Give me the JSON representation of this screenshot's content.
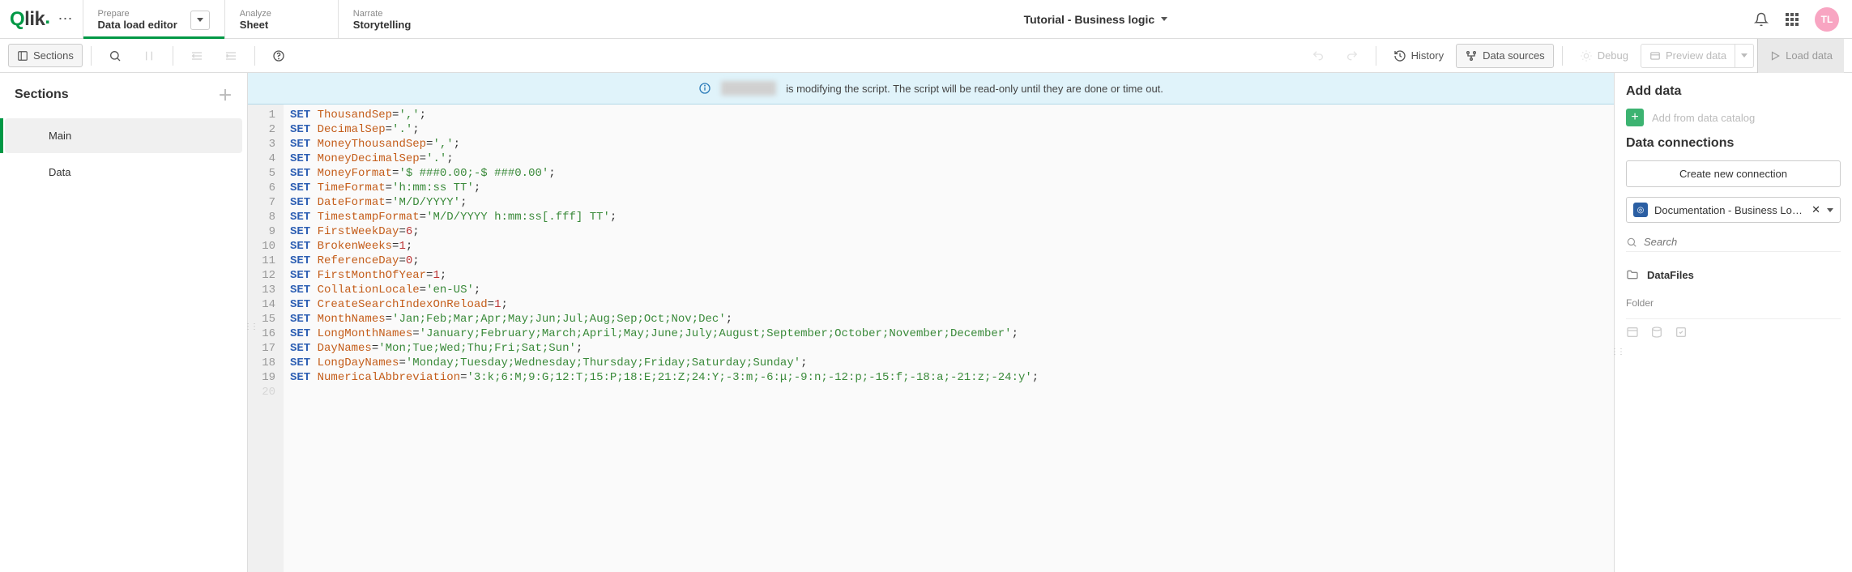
{
  "header": {
    "logo": "Qlik",
    "tabs": [
      {
        "small": "Prepare",
        "big": "Data load editor",
        "active": true,
        "hasDropdown": true
      },
      {
        "small": "Analyze",
        "big": "Sheet"
      },
      {
        "small": "Narrate",
        "big": "Storytelling"
      }
    ],
    "title": "Tutorial - Business logic",
    "avatarInitials": "TL"
  },
  "toolbar": {
    "sections": "Sections",
    "history": "History",
    "dataSources": "Data sources",
    "debug": "Debug",
    "previewData": "Preview data",
    "loadData": "Load data"
  },
  "sectionsPanel": {
    "title": "Sections",
    "items": [
      "Main",
      "Data"
    ],
    "activeIndex": 0
  },
  "banner": {
    "text_suffix": "is modifying the script. The script will be read-only until they are done or time out."
  },
  "code": {
    "lines": [
      {
        "n": 1,
        "kw": "SET",
        "var": "ThousandSep",
        "rest": "=','",
        "type": "str",
        "val": "','"
      },
      {
        "n": 2,
        "kw": "SET",
        "var": "DecimalSep",
        "rest": "='.'",
        "type": "str",
        "val": "'.'"
      },
      {
        "n": 3,
        "kw": "SET",
        "var": "MoneyThousandSep",
        "rest": "=','",
        "type": "str",
        "val": "','"
      },
      {
        "n": 4,
        "kw": "SET",
        "var": "MoneyDecimalSep",
        "rest": "='.'",
        "type": "str",
        "val": "'.'"
      },
      {
        "n": 5,
        "kw": "SET",
        "var": "MoneyFormat",
        "rest": "",
        "type": "str",
        "val": "'$ ###0.00;-$ ###0.00'"
      },
      {
        "n": 6,
        "kw": "SET",
        "var": "TimeFormat",
        "rest": "",
        "type": "str",
        "val": "'h:mm:ss TT'"
      },
      {
        "n": 7,
        "kw": "SET",
        "var": "DateFormat",
        "rest": "",
        "type": "str",
        "val": "'M/D/YYYY'"
      },
      {
        "n": 8,
        "kw": "SET",
        "var": "TimestampFormat",
        "rest": "",
        "type": "str",
        "val": "'M/D/YYYY h:mm:ss[.fff] TT'"
      },
      {
        "n": 9,
        "kw": "SET",
        "var": "FirstWeekDay",
        "rest": "",
        "type": "num",
        "val": "6"
      },
      {
        "n": 10,
        "kw": "SET",
        "var": "BrokenWeeks",
        "rest": "",
        "type": "num",
        "val": "1"
      },
      {
        "n": 11,
        "kw": "SET",
        "var": "ReferenceDay",
        "rest": "",
        "type": "num",
        "val": "0"
      },
      {
        "n": 12,
        "kw": "SET",
        "var": "FirstMonthOfYear",
        "rest": "",
        "type": "num",
        "val": "1"
      },
      {
        "n": 13,
        "kw": "SET",
        "var": "CollationLocale",
        "rest": "",
        "type": "str",
        "val": "'en-US'"
      },
      {
        "n": 14,
        "kw": "SET",
        "var": "CreateSearchIndexOnReload",
        "rest": "",
        "type": "num",
        "val": "1"
      },
      {
        "n": 15,
        "kw": "SET",
        "var": "MonthNames",
        "rest": "",
        "type": "str",
        "val": "'Jan;Feb;Mar;Apr;May;Jun;Jul;Aug;Sep;Oct;Nov;Dec'"
      },
      {
        "n": 16,
        "kw": "SET",
        "var": "LongMonthNames",
        "rest": "",
        "type": "str",
        "val": "'January;February;March;April;May;June;July;August;September;October;November;December'"
      },
      {
        "n": 17,
        "kw": "SET",
        "var": "DayNames",
        "rest": "",
        "type": "str",
        "val": "'Mon;Tue;Wed;Thu;Fri;Sat;Sun'"
      },
      {
        "n": 18,
        "kw": "SET",
        "var": "LongDayNames",
        "rest": "",
        "type": "str",
        "val": "'Monday;Tuesday;Wednesday;Thursday;Friday;Saturday;Sunday'"
      },
      {
        "n": 19,
        "kw": "SET",
        "var": "NumericalAbbreviation",
        "rest": "",
        "type": "str",
        "val": "'3:k;6:M;9:G;12:T;15:P;18:E;21:Z;24:Y;-3:m;-6:μ;-9:n;-12:p;-15:f;-18:a;-21:z;-24:y'"
      }
    ]
  },
  "rightPanel": {
    "addDataTitle": "Add data",
    "addFromCatalog": "Add from data catalog",
    "dataConnectionsTitle": "Data connections",
    "createConnection": "Create new connection",
    "connectionName": "Documentation - Business Logic ...",
    "searchPlaceholder": "Search",
    "dataFilesLabel": "DataFiles",
    "folderLabel": "Folder"
  }
}
